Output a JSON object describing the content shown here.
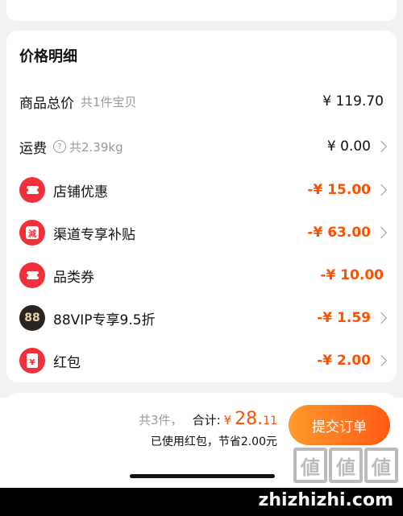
{
  "price_detail": {
    "title": "价格明细",
    "rows": [
      {
        "label": "商品总价",
        "sub": "共1件宝贝",
        "value": "¥ 119.70",
        "icon": "none",
        "has_chevron": false
      },
      {
        "label": "运费",
        "sub": "共2.39kg",
        "value": "¥ 0.00",
        "icon": "question-icon",
        "has_chevron": true
      },
      {
        "label": "店铺优惠",
        "value": "-¥ 15.00",
        "icon": "coupon-icon",
        "discount": true,
        "has_chevron": true
      },
      {
        "label": "渠道专享补贴",
        "value": "-¥ 63.00",
        "icon": "reduce-icon",
        "icon_text": "減",
        "discount": true,
        "has_chevron": true
      },
      {
        "label": "品类券",
        "value": "-¥ 10.00",
        "icon": "coupon-icon",
        "discount": true,
        "has_chevron": false
      },
      {
        "label": "88VIP专享9.5折",
        "value": "-¥ 1.59",
        "icon": "vip-88-icon",
        "icon_text": "88",
        "discount": true,
        "has_chevron": true
      },
      {
        "label": "红包",
        "value": "-¥ 2.00",
        "icon": "red-envelope-icon",
        "icon_text": "¥",
        "discount": true,
        "has_chevron": true
      }
    ]
  },
  "footer": {
    "count": "共3件，",
    "total_label": "合计:",
    "currency": "¥",
    "total_int": "28.",
    "total_dec": "11",
    "saved": "已使用红包，节省2.00元",
    "submit_label": "提交订单"
  },
  "watermark": {
    "text": "zhizhizhi.com",
    "logo_chars": [
      "値",
      "値",
      "値"
    ]
  },
  "colors": {
    "accent": "#ff5000",
    "icon_red": "#f2303b",
    "button_start": "#ff9a2e",
    "button_end": "#ff5a14"
  }
}
